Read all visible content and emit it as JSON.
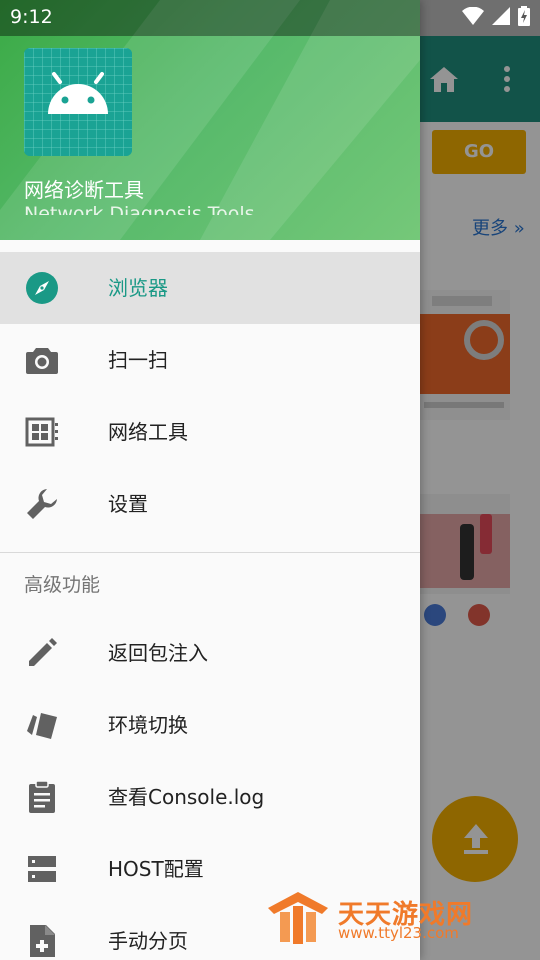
{
  "status_bar": {
    "time": "9:12"
  },
  "background": {
    "go_label": "GO",
    "more_label": "更多 »"
  },
  "drawer": {
    "title": "网络诊断工具",
    "subtitle": "Network Diagnosis Tools",
    "items": [
      {
        "label": "浏览器",
        "icon": "compass-icon",
        "active": true
      },
      {
        "label": "扫一扫",
        "icon": "camera-icon"
      },
      {
        "label": "网络工具",
        "icon": "dashboard-icon"
      },
      {
        "label": "设置",
        "icon": "wrench-icon"
      }
    ],
    "section_header": "高级功能",
    "advanced_items": [
      {
        "label": "返回包注入",
        "icon": "pencil-icon"
      },
      {
        "label": "环境切换",
        "icon": "swap-cards-icon"
      },
      {
        "label": "查看Console.log",
        "icon": "clipboard-icon"
      },
      {
        "label": "HOST配置",
        "icon": "server-icon"
      },
      {
        "label": "手动分页",
        "icon": "add-file-icon"
      }
    ]
  },
  "watermark": {
    "name": "天天游戏网",
    "url": "www.ttyl23.com"
  },
  "colors": {
    "accent": "#1a9986",
    "header_green": "#56b96a",
    "fab": "#f5b000"
  }
}
